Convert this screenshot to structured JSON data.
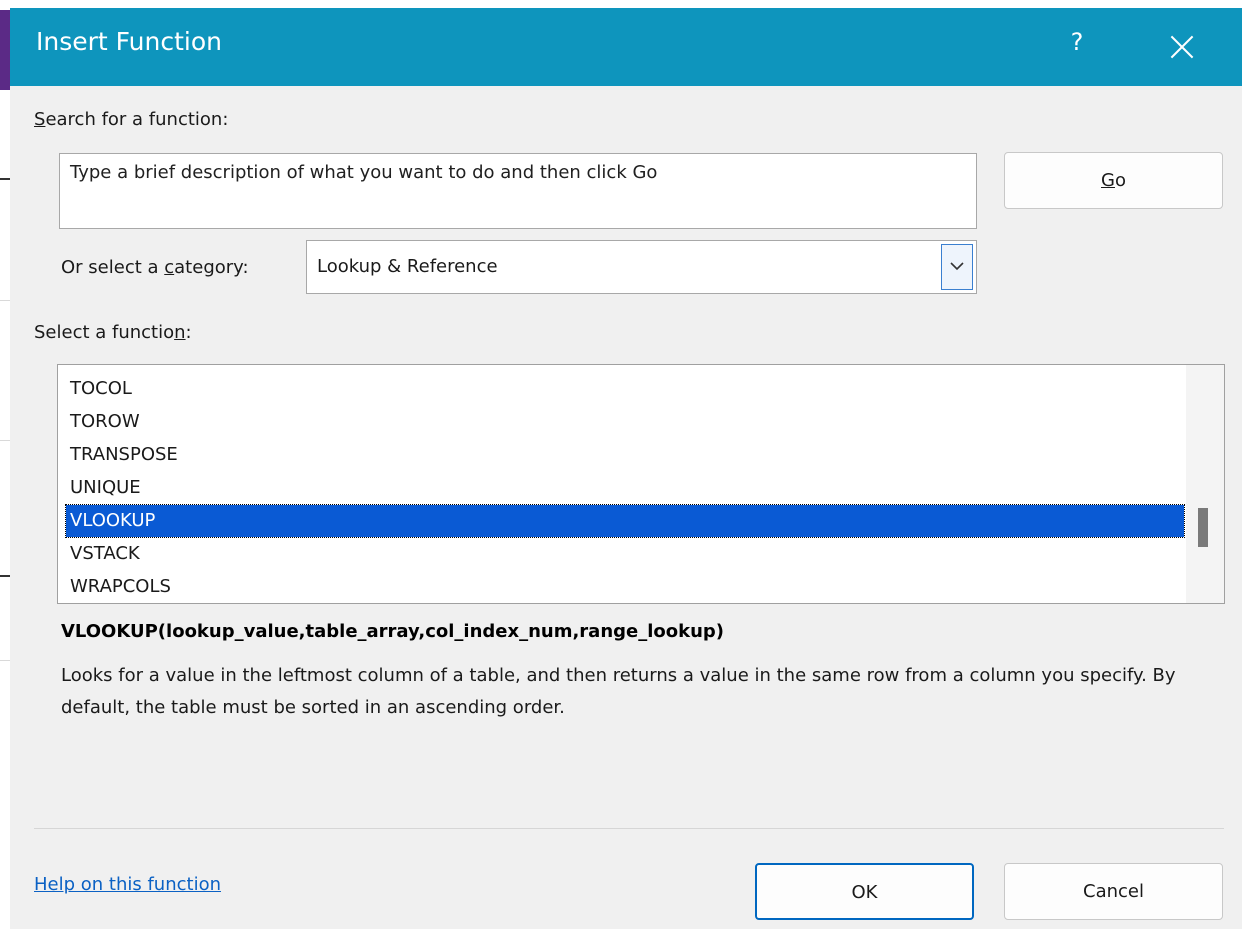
{
  "dialog": {
    "title": "Insert Function",
    "help_glyph": "?",
    "close_icon": "close-icon",
    "title_bar_color": "#0e95bd"
  },
  "search": {
    "label_accel": "S",
    "label_rest": "earch for a function:",
    "placeholder": "Type a brief description of what you want to do and then click Go",
    "go_accel": "G",
    "go_rest": "o"
  },
  "category": {
    "label_pre": "Or select a ",
    "label_accel": "c",
    "label_post": "ategory:",
    "selected": "Lookup & Reference",
    "dropdown_icon": "chevron-down-icon"
  },
  "functions": {
    "label_pre": "Select a functio",
    "label_accel": "n",
    "label_post": ":",
    "items": [
      "TOCOL",
      "TOROW",
      "TRANSPOSE",
      "UNIQUE",
      "VLOOKUP",
      "VSTACK",
      "WRAPCOLS"
    ],
    "selected": "VLOOKUP",
    "selection_color": "#0a5ad4"
  },
  "details": {
    "signature": "VLOOKUP(lookup_value,table_array,col_index_num,range_lookup)",
    "description": "Looks for a value in the leftmost column of a table, and then returns a value in the same row from a column you specify. By default, the table must be sorted in an ascending order."
  },
  "footer": {
    "help_link": "Help on this function",
    "ok_label": "OK",
    "cancel_label": "Cancel"
  }
}
